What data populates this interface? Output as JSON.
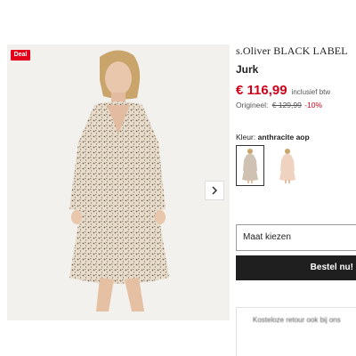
{
  "gallery": {
    "badge": "Deal",
    "next_icon": "chevron-right-icon",
    "image_subject": "model-in-printed-dress"
  },
  "product": {
    "brand": "s.Oliver BLACK LABEL",
    "name": "Jurk",
    "price": "€ 116,99",
    "vat_note": "inclusief btw",
    "original_label": "Origineel:",
    "original_price": "€ 129,99",
    "discount": "-10%"
  },
  "color": {
    "label": "Kleur:",
    "value": "anthracite aop",
    "swatches": [
      {
        "name": "anthracite aop",
        "selected": true
      },
      {
        "name": "beige",
        "selected": false
      }
    ]
  },
  "size": {
    "placeholder": "Maat kiezen"
  },
  "order": {
    "label": "Bestel nu!"
  },
  "peek": {
    "text": "Kosteloze retour ook bij ons"
  },
  "colors": {
    "deal_red": "#e3001b",
    "price_red": "#d0021b",
    "button_dark": "#1f1f1f"
  }
}
